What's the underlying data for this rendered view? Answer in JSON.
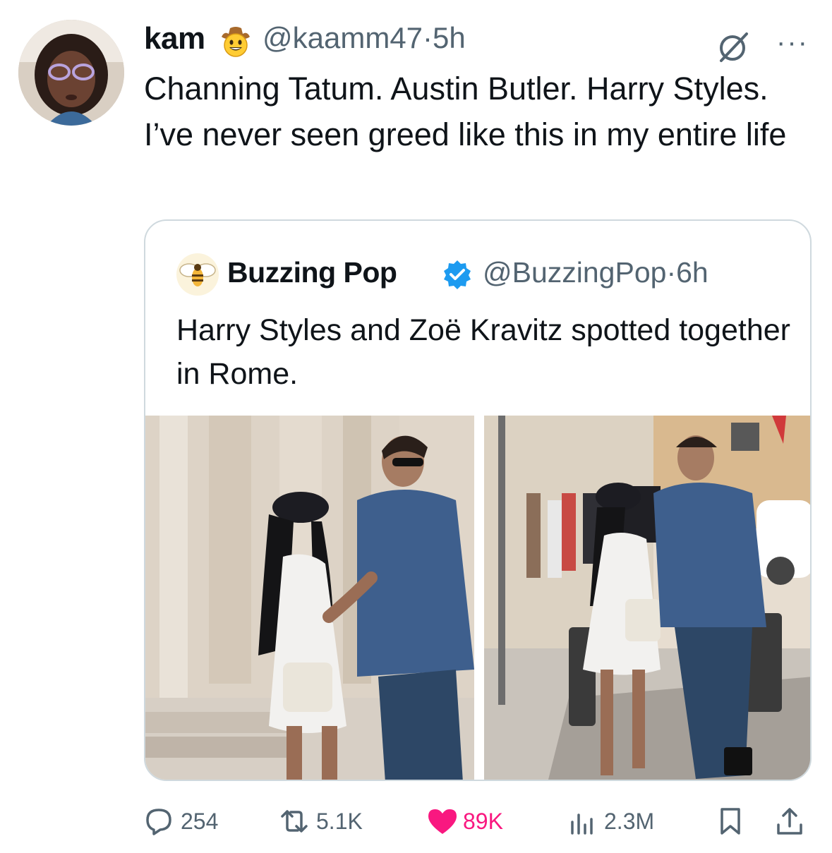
{
  "tweet": {
    "author_name": "kam",
    "author_emoji": "cowboy-face-emoji",
    "handle": "@kaamm47",
    "separator": "·",
    "time": "5h",
    "text": "Channing Tatum. Austin Butler. Harry Styles. I’ve never seen greed like this in my entire life",
    "more_label": "···"
  },
  "quote": {
    "author_name": "Buzzing Pop",
    "verified_icon": "verified-badge-icon",
    "handle": "@BuzzingPop",
    "separator": "·",
    "time": "6h",
    "text": "Harry Styles and Zoë Kravitz spotted together in Rome.",
    "images": [
      "photo-1",
      "photo-2"
    ]
  },
  "actions": {
    "replies": "254",
    "retweets": "5.1K",
    "likes": "89K",
    "views": "2.3M"
  },
  "colors": {
    "text": "#0f1419",
    "secondary": "#536471",
    "like": "#f91880",
    "verified": "#1d9bf0",
    "border": "#cfd9de"
  }
}
